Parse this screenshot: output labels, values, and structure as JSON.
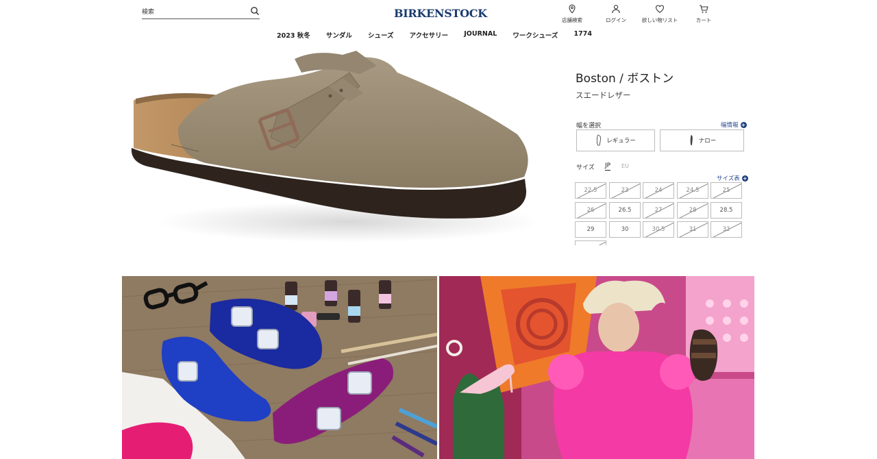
{
  "header": {
    "search": {
      "placeholder": "検索",
      "icon": "search-icon"
    },
    "logo": "BIRKENSTOCK",
    "utilities": [
      {
        "label": "店舗検索",
        "icon": "map-pin-icon"
      },
      {
        "label": "ログイン",
        "icon": "user-icon"
      },
      {
        "label": "欲しい物リスト",
        "icon": "heart-icon"
      },
      {
        "label": "カート",
        "icon": "cart-icon"
      }
    ]
  },
  "nav": {
    "items": [
      "2023 秋冬",
      "サンダル",
      "シューズ",
      "アクセサリー",
      "JOURNAL",
      "ワークシューズ",
      "1774"
    ]
  },
  "product": {
    "title": "Boston / ボストン",
    "material": "スエードレザー",
    "width_label": "幅を選択",
    "width_info": "幅情報",
    "width_options": [
      {
        "label": "レギュラー",
        "icon": "regular-foot-icon"
      },
      {
        "label": "ナロー",
        "icon": "narrow-foot-icon"
      }
    ],
    "size_label": "サイズ",
    "size_systems": [
      {
        "label": "JP",
        "active": true
      },
      {
        "label": "EU",
        "active": false
      }
    ],
    "size_chart": "サイズ表",
    "sizes": [
      {
        "label": "22.5",
        "available": false
      },
      {
        "label": "23",
        "available": false
      },
      {
        "label": "24",
        "available": false
      },
      {
        "label": "24.5",
        "available": false
      },
      {
        "label": "25",
        "available": false
      },
      {
        "label": "26",
        "available": false
      },
      {
        "label": "26.5",
        "available": true
      },
      {
        "label": "27",
        "available": false
      },
      {
        "label": "28",
        "available": false
      },
      {
        "label": "28.5",
        "available": true
      },
      {
        "label": "29",
        "available": true
      },
      {
        "label": "30",
        "available": true
      },
      {
        "label": "30.5",
        "available": false
      },
      {
        "label": "31",
        "available": false
      },
      {
        "label": "32",
        "available": false
      },
      {
        "label": "",
        "available": false
      }
    ]
  },
  "colors": {
    "brand": "#1a3b6e",
    "suede": "#9a8c74",
    "cork": "#b88b5a",
    "barbie_pink": "#e5388f"
  }
}
